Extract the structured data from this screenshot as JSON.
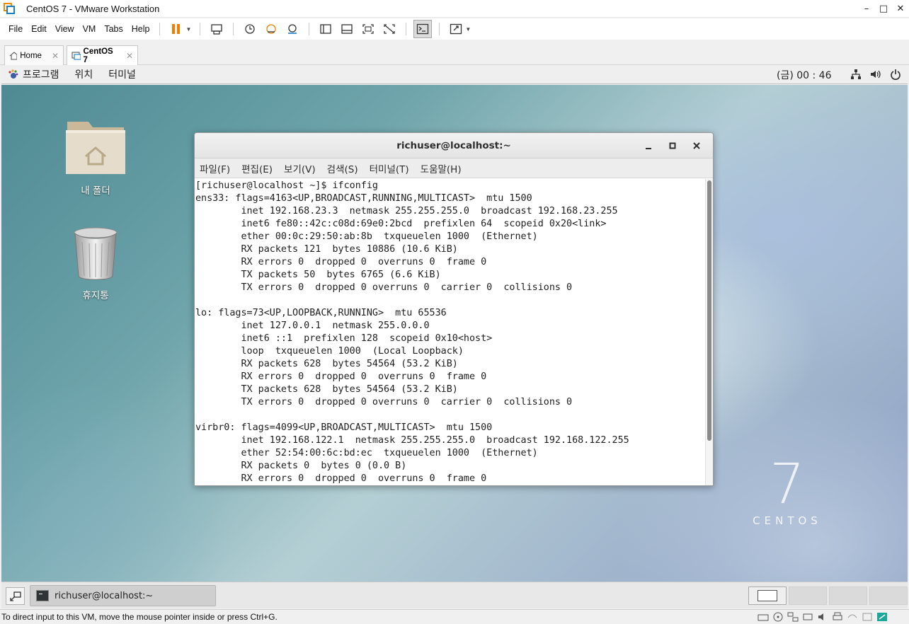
{
  "app": {
    "title": "CentOS 7 - VMware Workstation",
    "window_controls": {
      "minimize": "–",
      "maximize": "□",
      "close": "✕"
    }
  },
  "menu": {
    "items": [
      "File",
      "Edit",
      "View",
      "VM",
      "Tabs",
      "Help"
    ]
  },
  "toolbar": {
    "icons": [
      "pause-icon",
      "send-ctrl-alt-del-icon",
      "snapshot-take-icon",
      "snapshot-revert-icon",
      "snapshot-manager-icon",
      "library-icon",
      "thumbnail-bar-icon",
      "full-screen-icon",
      "unity-icon",
      "console-view-icon",
      "fit-guest-icon"
    ],
    "accent": "#f07d00"
  },
  "tabs": [
    {
      "label": "Home",
      "active": false
    },
    {
      "label": "CentOS 7",
      "active": true
    }
  ],
  "gnome": {
    "menus": [
      "프로그램",
      "위치",
      "터미널"
    ],
    "clock": "(금) 00 : 46",
    "tray": [
      "network-icon",
      "volume-icon",
      "power-icon"
    ]
  },
  "desktop": {
    "icons": [
      {
        "label": "내 폴더",
        "icon": "home-folder-icon"
      },
      {
        "label": "휴지통",
        "icon": "trash-icon"
      }
    ],
    "brand": {
      "number": "7",
      "word": "CENTOS"
    }
  },
  "terminal": {
    "title": "richuser@localhost:~",
    "menu": [
      "파일(F)",
      "편집(E)",
      "보기(V)",
      "검색(S)",
      "터미널(T)",
      "도움말(H)"
    ],
    "lines": [
      "[richuser@localhost ~]$ ifconfig",
      "ens33: flags=4163<UP,BROADCAST,RUNNING,MULTICAST>  mtu 1500",
      "        inet 192.168.23.3  netmask 255.255.255.0  broadcast 192.168.23.255",
      "        inet6 fe80::42c:c08d:69e0:2bcd  prefixlen 64  scopeid 0x20<link>",
      "        ether 00:0c:29:50:ab:8b  txqueuelen 1000  (Ethernet)",
      "        RX packets 121  bytes 10886 (10.6 KiB)",
      "        RX errors 0  dropped 0  overruns 0  frame 0",
      "        TX packets 50  bytes 6765 (6.6 KiB)",
      "        TX errors 0  dropped 0 overruns 0  carrier 0  collisions 0",
      "",
      "lo: flags=73<UP,LOOPBACK,RUNNING>  mtu 65536",
      "        inet 127.0.0.1  netmask 255.0.0.0",
      "        inet6 ::1  prefixlen 128  scopeid 0x10<host>",
      "        loop  txqueuelen 1000  (Local Loopback)",
      "        RX packets 628  bytes 54564 (53.2 KiB)",
      "        RX errors 0  dropped 0  overruns 0  frame 0",
      "        TX packets 628  bytes 54564 (53.2 KiB)",
      "        TX errors 0  dropped 0 overruns 0  carrier 0  collisions 0",
      "",
      "virbr0: flags=4099<UP,BROADCAST,MULTICAST>  mtu 1500",
      "        inet 192.168.122.1  netmask 255.255.255.0  broadcast 192.168.122.255",
      "        ether 52:54:00:6c:bd:ec  txqueuelen 1000  (Ethernet)",
      "        RX packets 0  bytes 0 (0.0 B)",
      "        RX errors 0  dropped 0  overruns 0  frame 0"
    ]
  },
  "taskbar": {
    "window_label": "richuser@localhost:~",
    "workspaces": 4
  },
  "status": {
    "text": "To direct input to this VM, move the mouse pointer inside or press Ctrl+G."
  }
}
